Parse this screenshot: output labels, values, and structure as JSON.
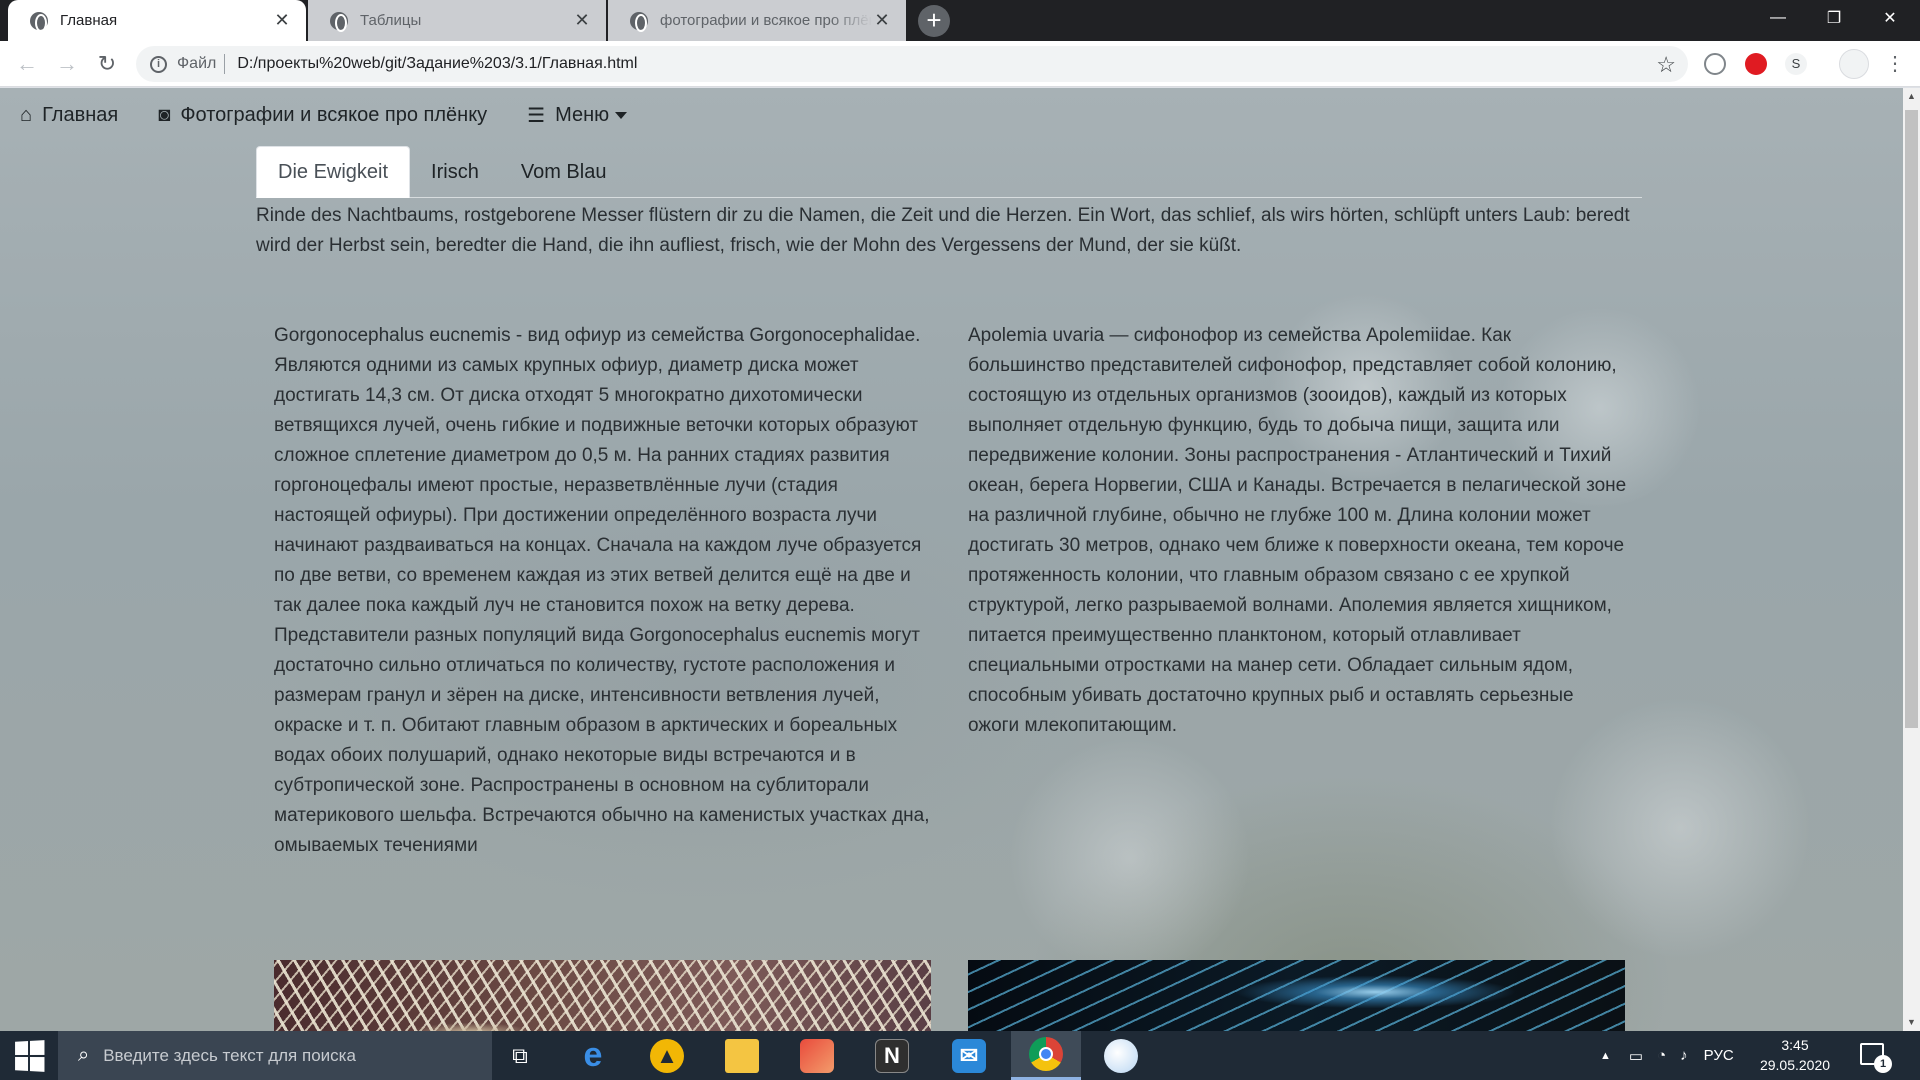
{
  "browser": {
    "tabs": [
      {
        "title": "Главная",
        "active": true
      },
      {
        "title": "Таблицы",
        "active": false
      },
      {
        "title": "фотографии и всякое про плёнку",
        "active": false
      }
    ],
    "new_tab": "+",
    "window_controls": {
      "minimize": "—",
      "maximize": "❐",
      "close": "✕"
    },
    "address": {
      "scheme_label": "Файл",
      "url": "D:/проекты%20web/git/Задание%203/3.1/Главная.html"
    },
    "extension_profile_letter": "S"
  },
  "site": {
    "nav": [
      {
        "label": "Главная",
        "icon": "home-icon"
      },
      {
        "label": "Фотографии и всякое про плёнку",
        "icon": "camera-icon"
      },
      {
        "label": "Меню",
        "icon": "list-icon"
      }
    ],
    "tabs": [
      {
        "label": "Die Ewigkeit",
        "active": true
      },
      {
        "label": "Irisch",
        "active": false
      },
      {
        "label": "Vom Blau",
        "active": false
      }
    ],
    "intro": "Rinde des Nachtbaums, rostgeborene Messer flüstern dir zu die Namen, die Zeit und die Herzen. Ein Wort, das schlief, als wirs hörten, schlüpft unters Laub: beredt wird der Herbst sein, beredter die Hand, die ihn aufliest, frisch, wie der Mohn des Vergessens der Mund, der sie küßt.",
    "articles": [
      {
        "text": "Gorgonocephalus eucnemis - вид офиур из семейства Gorgonocephalidae. Являются одними из самых крупных офиур, диаметр диска может достигать 14,3 см. От диска отходят 5 многократно дихотомически ветвящихся лучей, очень гибкие и подвижные веточки которых образуют сложное сплетение диаметром до 0,5 м. На ранних стадиях развития горгоноцефалы имеют простые, неразветвлённые лучи (стадия настоящей офиуры). При достижении определённого возраста лучи начинают раздваиваться на концах. Сначала на каждом луче образуется по две ветви, со временем каждая из этих ветвей делится ещё на две и так далее пока каждый луч не становится похож на ветку дерева. Представители разных популяций вида Gorgonocephalus eucnemis могут достаточно сильно отличаться по количеству, густоте расположения и размерам гранул и зёрен на диске, интенсивности ветвления лучей, окраске и т. п. Обитают главным образом в арктических и бореальных водах обоих полушарий, однако некоторые виды встречаются и в субтропической зоне. Распространены в основном на сублиторали материкового шельфа. Встречаются обычно на каменистых участках дна, омываемых течениями"
      },
      {
        "text": "Apolemia uvaria — сифонофор из семейства Apolemiidae. Как большинство представителей сифонофор, представляет собой колонию, состоящую из отдельных организмов (зооидов), каждый из которых выполняет отдельную функцию, будь то добыча пищи, защита или передвижение колонии. Зоны распространения - Атлантический и Тихий океан, берега Норвегии, США и Канады. Встречается в пелагической зоне на различной глубине, обычно не глубже 100 м. Длина колонии может достигать 30 метров, однако чем ближе к поверхности океана, тем короче протяженность колонии, что главным образом связано с ее хрупкой структурой, легко разрываемой волнами. Аполемия является хищником, питается преимущественно планктоном, который отлавливает специальными отростками на манер сети. Обладает сильным ядом, способным убивать достаточно крупных рыб и оставлять серьезные ожоги млекопитающим."
      }
    ]
  },
  "taskbar": {
    "search_placeholder": "Введите здесь текст для поиска",
    "language": "РУС",
    "time": "3:45",
    "date": "29.05.2020",
    "notification_count": "1"
  },
  "colors": {
    "tab_strip": "#202124",
    "page_background": "#9ea9ad",
    "taskbar": "#1f2a36"
  }
}
